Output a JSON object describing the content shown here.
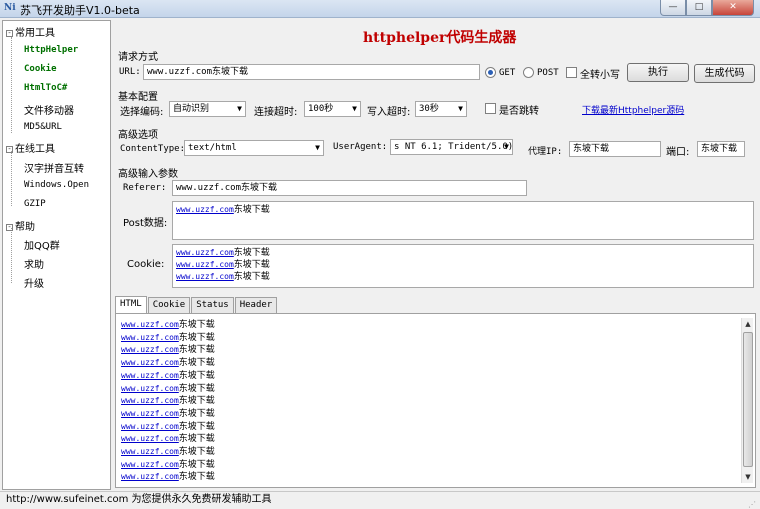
{
  "window": {
    "icon_text": "Ni",
    "title": "苏飞开发助手V1.0-beta",
    "minimize": "—",
    "maximize": "□",
    "close": "✕"
  },
  "tree": {
    "groups": [
      {
        "label": "常用工具",
        "items": [
          "HttpHelper",
          "Cookie",
          "HtmlToC#",
          "文件移动器",
          "MD5&URL"
        ]
      },
      {
        "label": "在线工具",
        "items": [
          "汉字拼音互转",
          "Windows.Open",
          "GZIP"
        ]
      },
      {
        "label": "帮助",
        "items": [
          "加QQ群",
          "求助",
          "升级"
        ]
      }
    ],
    "expander": "-"
  },
  "main": {
    "header": "httphelper代码生成器",
    "request": {
      "section_label": "请求方式",
      "url_label": "URL:",
      "url_value": "www.uzzf.com东坡下载",
      "get_label": "GET",
      "post_label": "POST",
      "lowercase_label": "全转小写",
      "execute_button": "执行",
      "generate_button": "生成代码",
      "method_selected": "GET"
    },
    "basic": {
      "section_label": "基本配置",
      "encoding_label": "选择编码:",
      "encoding_value": "自动识别",
      "timeout_label": "连接超时:",
      "timeout_value": "100秒",
      "write_timeout_label": "写入超时:",
      "write_timeout_value": "30秒",
      "redirect_label": "是否跳转",
      "download_link": "下载最新Httphelper源码"
    },
    "advanced": {
      "section_label": "高级选项",
      "content_type_label": "ContentType:",
      "content_type_value": "text/html",
      "user_agent_label": "UserAgent:",
      "user_agent_value": "s NT 6.1; Trident/5.0)",
      "proxy_label": "代理IP:",
      "proxy_value": "东坡下载",
      "port_label": "端口:",
      "port_value": "东坡下载"
    },
    "advanced_input": {
      "section_label": "高级输入参数",
      "referer_label": "Referer:",
      "referer_value": "www.uzzf.com东坡下载",
      "post_label": "Post数据:",
      "post_lines": [
        {
          "link": "www.uzzf.com",
          "text": "东坡下载"
        }
      ],
      "cookie_label": "Cookie:",
      "cookie_lines": [
        {
          "link": "www.uzzf.com",
          "text": "东坡下载"
        },
        {
          "link": "www.uzzf.com",
          "text": "东坡下载"
        },
        {
          "link": "www.uzzf.com",
          "text": "东坡下载"
        }
      ]
    },
    "tabs": [
      "HTML",
      "Cookie",
      "Status",
      "Header"
    ],
    "active_tab": "HTML",
    "output_lines": [
      {
        "link": "www.uzzf.com",
        "text": "东坡下载"
      },
      {
        "link": "www.uzzf.com",
        "text": "东坡下载"
      },
      {
        "link": "www.uzzf.com",
        "text": "东坡下载"
      },
      {
        "link": "www.uzzf.com",
        "text": "东坡下载"
      },
      {
        "link": "www.uzzf.com",
        "text": "东坡下载"
      },
      {
        "link": "www.uzzf.com",
        "text": "东坡下载"
      },
      {
        "link": "www.uzzf.com",
        "text": "东坡下载"
      },
      {
        "link": "www.uzzf.com",
        "text": "东坡下载"
      },
      {
        "link": "www.uzzf.com",
        "text": "东坡下载"
      },
      {
        "link": "www.uzzf.com",
        "text": "东坡下载"
      },
      {
        "link": "www.uzzf.com",
        "text": "东坡下载"
      },
      {
        "link": "www.uzzf.com",
        "text": "东坡下载"
      },
      {
        "link": "www.uzzf.com",
        "text": "东坡下载"
      }
    ]
  },
  "statusbar": {
    "text": "http://www.sufeinet.com 为您提供永久免费研发辅助工具"
  },
  "colors": {
    "header_red": "#c00000",
    "tree_green": "#007000",
    "link_blue": "#0000cc"
  }
}
